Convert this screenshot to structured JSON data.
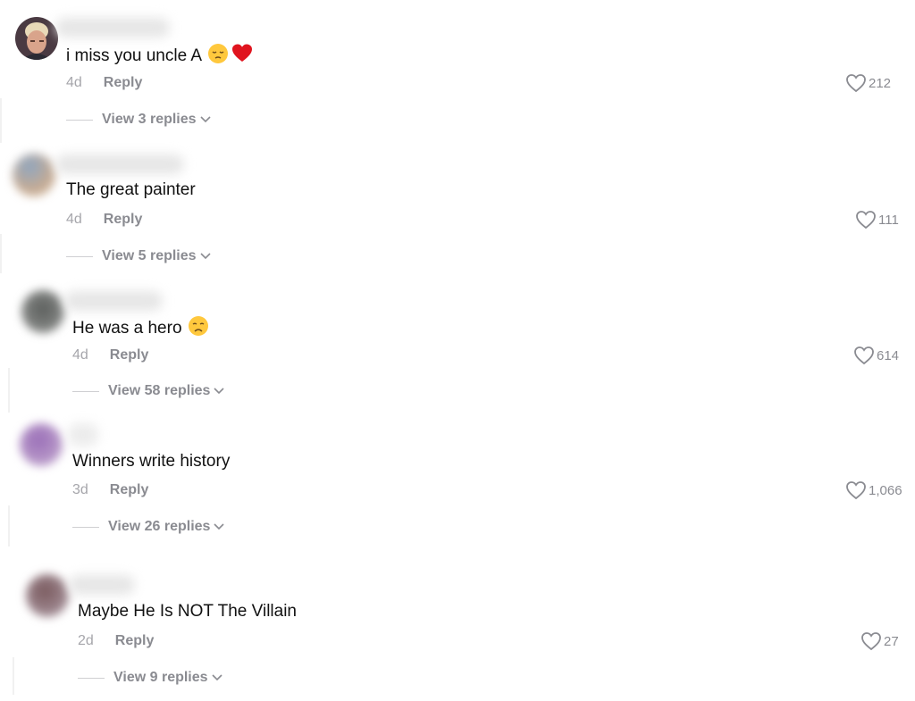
{
  "comments": [
    {
      "text": "i miss you uncle A",
      "emojis": [
        "pensive-face",
        "red-heart"
      ],
      "age": "4d",
      "reply_label": "Reply",
      "likes": "212",
      "view_replies": "View 3 replies"
    },
    {
      "text": "The great painter",
      "emojis": [],
      "age": "4d",
      "reply_label": "Reply",
      "likes": "111",
      "view_replies": "View 5 replies"
    },
    {
      "text": "He was a hero",
      "emojis": [
        "disappointed-face"
      ],
      "age": "4d",
      "reply_label": "Reply",
      "likes": "614",
      "view_replies": "View 58 replies"
    },
    {
      "text": "Winners write history",
      "emojis": [],
      "age": "3d",
      "reply_label": "Reply",
      "likes": "1,066",
      "view_replies": "View 26 replies"
    },
    {
      "text": "Maybe He Is NOT The Villain",
      "emojis": [],
      "age": "2d",
      "reply_label": "Reply",
      "likes": "27",
      "view_replies": "View 9 replies"
    }
  ],
  "colors": {
    "text": "#111111",
    "muted": "#8a8b91",
    "age": "#a6a6ab",
    "emoji_yellow": "#ffc83d",
    "heart_red": "#e0141e"
  }
}
